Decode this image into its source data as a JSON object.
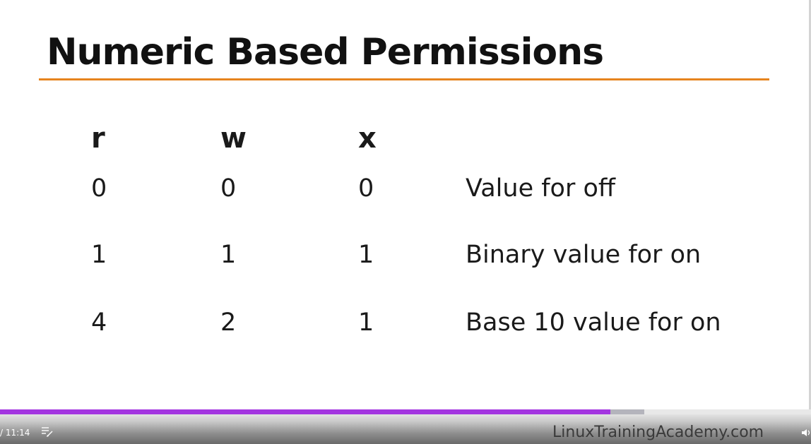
{
  "slide": {
    "title": "Numeric Based Permissions",
    "headers": [
      "r",
      "w",
      "x"
    ],
    "rows": [
      {
        "r": "0",
        "w": "0",
        "x": "0",
        "description": "Value for off"
      },
      {
        "r": "1",
        "w": "1",
        "x": "1",
        "description": "Binary value for on"
      },
      {
        "r": "4",
        "w": "2",
        "x": "1",
        "description": "Base 10 value for on"
      }
    ],
    "accent_color": "#e6841e"
  },
  "player": {
    "time_display": "/ 11:14",
    "played_fraction": 0.753,
    "buffered_fraction": 0.794,
    "progress_color": "#a335e0",
    "notes_icon": "notes-edit-icon",
    "volume_icon": "speaker-icon",
    "brand": "LinuxTrainingAcademy.com"
  }
}
